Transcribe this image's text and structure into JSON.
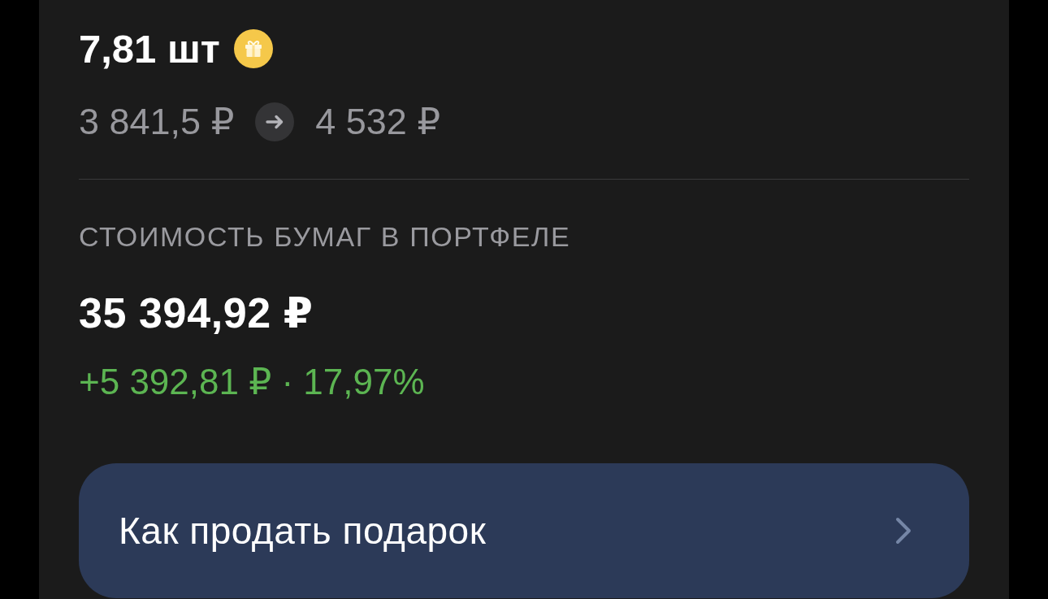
{
  "holding": {
    "quantity": "7,81 шт"
  },
  "price_change": {
    "from": "3 841,5 ₽",
    "to": "4 532 ₽"
  },
  "portfolio_value": {
    "label": "СТОИМОСТЬ БУМАГ В ПОРТФЕЛЕ",
    "amount": "35 394,92 ₽",
    "change": "+5 392,81 ₽ · 17,97%",
    "positive": true
  },
  "action_button": {
    "label": "Как продать подарок"
  }
}
